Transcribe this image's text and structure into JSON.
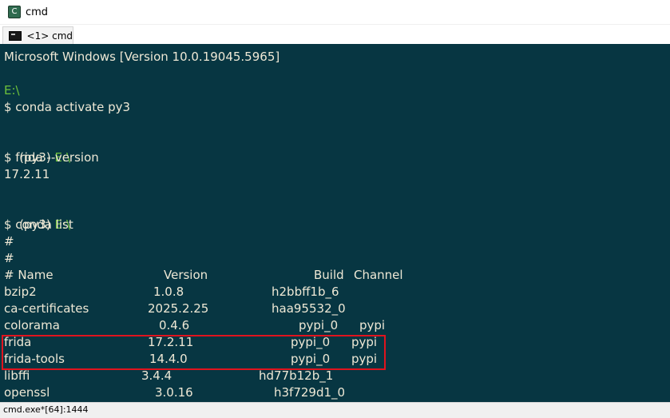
{
  "window": {
    "title": "cmd",
    "app_icon": "console-emulator-icon",
    "icon_glyph": "C"
  },
  "tab": {
    "label": "<1> cmd",
    "icon": "console-icon"
  },
  "console": {
    "header": "Microsoft Windows [Version 10.0.19045.5965]",
    "prompts": [
      {
        "env": "",
        "path": "E:\\",
        "command": "$ conda activate py3"
      },
      {
        "env": "(py3)",
        "path": "E:\\",
        "command": "$ frida --version",
        "output": "17.2.11"
      },
      {
        "env": "(py3)",
        "path": "E:\\",
        "command": "$ conda list"
      }
    ],
    "comment_lines": [
      "#",
      "#"
    ],
    "table_header": {
      "name": "# Name",
      "version": "Version",
      "build": "Build",
      "channel": "Channel"
    },
    "packages": [
      {
        "name": "bzip2",
        "version": "1.0.8",
        "build": "h2bbff1b_6",
        "channel": ""
      },
      {
        "name": "ca-certificates",
        "version": "2025.2.25",
        "build": "haa95532_0",
        "channel": ""
      },
      {
        "name": "colorama",
        "version": "0.4.6",
        "build": "pypi_0",
        "channel": "pypi"
      },
      {
        "name": "frida",
        "version": "17.2.11",
        "build": "pypi_0",
        "channel": "pypi"
      },
      {
        "name": "frida-tools",
        "version": "14.4.0",
        "build": "pypi_0",
        "channel": "pypi"
      },
      {
        "name": "libffi",
        "version": "3.4.4",
        "build": "hd77b12b_1",
        "channel": ""
      },
      {
        "name": "openssl",
        "version": "3.0.16",
        "build": "h3f729d1_0",
        "channel": ""
      }
    ]
  },
  "statusbar": {
    "text": "cmd.exe*[64]:1444"
  },
  "colors": {
    "console_bg": "#073642",
    "console_text": "#eee8d5",
    "path_green": "#6cc13a",
    "highlight_red": "#e0141e"
  }
}
